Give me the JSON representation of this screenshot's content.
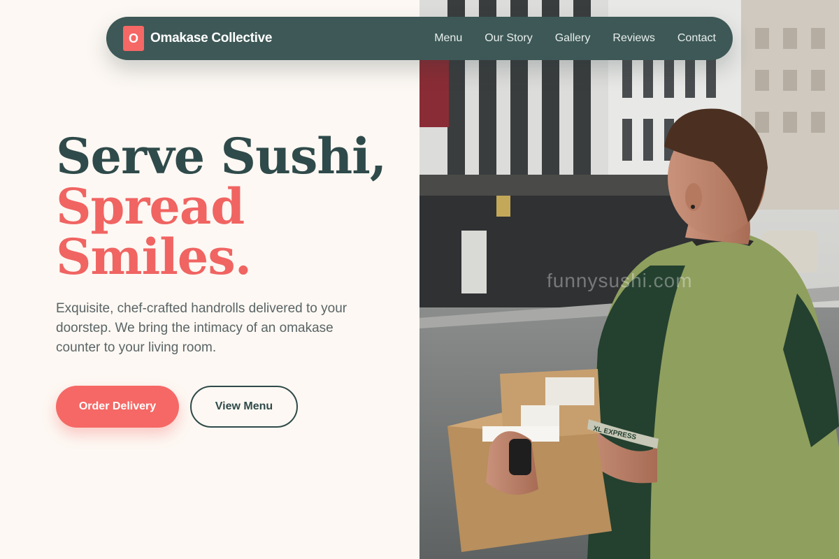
{
  "nav": {
    "logo_letter": "O",
    "brand": "Omakase Collective",
    "links": [
      "Menu",
      "Our Story",
      "Gallery",
      "Reviews",
      "Contact"
    ]
  },
  "hero": {
    "headline_line1": "Serve Sushi,",
    "headline_line2": "Spread",
    "headline_line3": "Smiles.",
    "subcopy": "Exquisite, chef-crafted handrolls delivered to your doorstep. We bring the intimacy of an omakase counter to your living room.",
    "primary_button": "Order Delivery",
    "secondary_button": "View Menu"
  },
  "photo": {
    "watermark": "funnysushi.com",
    "box_text": "XL EXPRESS"
  },
  "colors": {
    "primary": "#f56865",
    "dark": "#2f4a4a",
    "nav_bg": "#3d5856",
    "page_bg": "#fdf8f3"
  }
}
